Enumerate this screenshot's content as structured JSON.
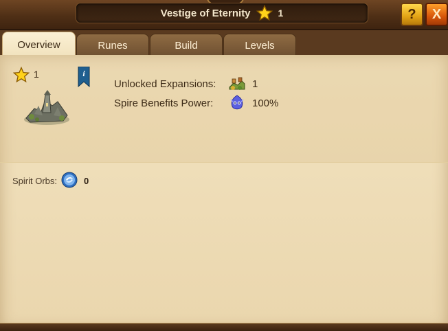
{
  "header": {
    "title": "Vestige of Eternity",
    "star_count": "1",
    "help_label": "?",
    "close_label": "X"
  },
  "tabs": [
    {
      "label": "Overview",
      "active": true
    },
    {
      "label": "Runes",
      "active": false
    },
    {
      "label": "Build",
      "active": false
    },
    {
      "label": "Levels",
      "active": false
    }
  ],
  "overview": {
    "level": "1",
    "stats": [
      {
        "label": "Unlocked Expansions:",
        "value": "1",
        "icon": "expansion-icon"
      },
      {
        "label": "Spire Benefits Power:",
        "value": "100%",
        "icon": "spire-spirit-icon"
      }
    ],
    "spirit_orbs_label": "Spirit Orbs:",
    "spirit_orbs_value": "0"
  },
  "colors": {
    "header_bg": "#4d2e15",
    "panel_bg": "#efdeb9",
    "tab_active": "#f1e2bd",
    "tab_inactive": "#7b5a38",
    "help_button": "#e3a315",
    "close_button": "#d7560b"
  }
}
